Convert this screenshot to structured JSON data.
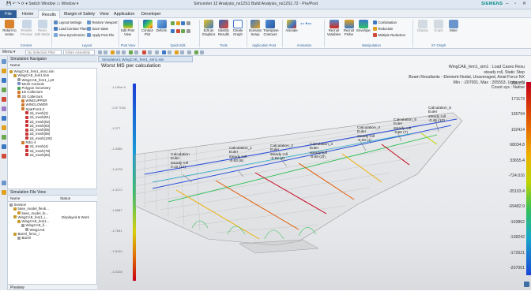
{
  "window": {
    "title": "Simcenter 12 Analysis_nx12S1 Build Analysis_nx12S1.72 - Pre/Post",
    "brand": "SIEMENS",
    "quick_access": "💾 ↶ ↷ ⟳ ▾  Switch Window  ▭ Window ▾"
  },
  "tabs": [
    "File",
    "Home",
    "Results",
    "Margin of Safety",
    "View",
    "Application",
    "Developer"
  ],
  "find_command": "Find a Command",
  "ribbon": {
    "context": {
      "big": [
        {
          "label": "Return to Home"
        },
        {
          "label": "Results Preview"
        },
        {
          "label": "Reset Edit Mode"
        }
      ],
      "group": "Context"
    },
    "layout": {
      "items": [
        "Layout Settings",
        "Load Contour Plans",
        "View Synchronize",
        "Restore Viewport",
        "Save State",
        "Apply Post File"
      ],
      "group": "Layout"
    },
    "postview": {
      "big": [
        {
          "label": "Edit Post View"
        }
      ],
      "group": "Post View"
    },
    "quickedit": {
      "big": [
        {
          "label": "Contour Plot"
        },
        {
          "label": "Deform"
        }
      ],
      "group": "Quick Edit"
    },
    "tools": {
      "big": [
        {
          "label": "Edit as Graphics"
        },
        {
          "label": "Identify Results"
        },
        {
          "label": "Create Graph"
        }
      ],
      "group": "Tools"
    },
    "application": {
      "big": [
        {
          "label": "Scenario Setup"
        },
        {
          "label": "Transpose Contours"
        }
      ],
      "group": "Application Post"
    },
    "animation": {
      "big": [
        {
          "label": "Animate"
        }
      ],
      "group": "Animation"
    },
    "manipulation": {
      "big": [
        {
          "label": "Recruit Variables"
        },
        {
          "label": "Recruit Probe"
        },
        {
          "label": "Envelope"
        }
      ],
      "items": [
        "Combination",
        "Reduction",
        "Multiple Reduction"
      ],
      "group": "Manipulation"
    },
    "xygraph": {
      "big": [
        {
          "label": "Display"
        },
        {
          "label": "Graph"
        },
        {
          "label": "More"
        }
      ],
      "group": "XY Graph"
    }
  },
  "cmdbar": {
    "menu": "Menu ▾",
    "filter1": "No Selection Filter",
    "filter2": "Entire Assembly"
  },
  "navigator": {
    "title": "Simulation Navigator",
    "column": "Name",
    "items": [
      {
        "label": "WingCAE_fem1_sim1.sim",
        "indent": 0,
        "color": "#c79a2b"
      },
      {
        "label": "WingCAE_fem1.fem",
        "indent": 1,
        "color": "#c79a2b"
      },
      {
        "label": "WingCAE_fem1_i.prt",
        "indent": 2,
        "color": "#9a9a9a"
      },
      {
        "label": "Mesh Controls",
        "indent": 2,
        "color": "#7b8fc9"
      },
      {
        "label": "Polygon Geometry",
        "indent": 2,
        "color": "#4aa35b"
      },
      {
        "label": "1D Collectors",
        "indent": 2,
        "color": "#cf7a2b"
      },
      {
        "label": "2D Collectors",
        "indent": 2,
        "color": "#cf7a2b"
      },
      {
        "label": "WINGUPPER",
        "indent": 3,
        "color": "#cf7a2b"
      },
      {
        "label": "WINGLOWER",
        "indent": 3,
        "color": "#cf7a2b"
      },
      {
        "label": "SparFront-3",
        "indent": 3,
        "color": "#cf7a2b"
      },
      {
        "label": "2d_mesh(3)",
        "indent": 4,
        "color": "#c83232"
      },
      {
        "label": "2d_mesh(81)",
        "indent": 4,
        "color": "#c83232"
      },
      {
        "label": "2d_mesh(82)",
        "indent": 4,
        "color": "#c83232"
      },
      {
        "label": "2d_mesh(83)",
        "indent": 4,
        "color": "#c83232"
      },
      {
        "label": "2d_mesh(85)",
        "indent": 4,
        "color": "#c83232"
      },
      {
        "label": "2d_mesh(86)",
        "indent": 4,
        "color": "#c83232"
      },
      {
        "label": "2d_mesh(100)",
        "indent": 4,
        "color": "#c83232"
      },
      {
        "label": "Rib1-4",
        "indent": 3,
        "color": "#cf7a2b"
      },
      {
        "label": "2d_mesh(4)",
        "indent": 4,
        "color": "#c83232"
      },
      {
        "label": "2d_mesh(78)",
        "indent": 4,
        "color": "#c83232"
      },
      {
        "label": "2d_mesh(80)",
        "indent": 4,
        "color": "#c83232"
      }
    ]
  },
  "fileview": {
    "title": "Simulation File View",
    "columns": [
      "Name",
      "Status"
    ],
    "items": [
      {
        "label": "Session",
        "status": "",
        "indent": 0,
        "color": "#9a9a9a"
      },
      {
        "label": "base_model_flexb...",
        "status": "",
        "indent": 1,
        "color": "#c79a2b"
      },
      {
        "label": "base_model_fe...",
        "status": "",
        "indent": 2,
        "color": "#c79a2b"
      },
      {
        "label": "WingCAE_fem1_i...",
        "status": "Displayed & Work",
        "indent": 1,
        "color": "#c79a2b"
      },
      {
        "label": "WingCAE_fem1...",
        "status": "",
        "indent": 2,
        "color": "#c79a2b"
      },
      {
        "label": "WingCAE_fi...",
        "status": "",
        "indent": 3,
        "color": "#9a9a9a"
      },
      {
        "label": "WingCAE",
        "status": "",
        "indent": 4,
        "color": "#9a9a9a"
      },
      {
        "label": "Barrel_fem1_i",
        "status": "",
        "indent": 1,
        "color": "#c79a2b"
      },
      {
        "label": "Barrel",
        "status": "",
        "indent": 2,
        "color": "#9a9a9a"
      }
    ],
    "footer": "Preview"
  },
  "viewport": {
    "tab": "Simulation1 WingCAE_fem1_sim1.sim",
    "title": "Worst MS per calculation",
    "info": [
      "WingCAE_fem1_sim1 : Load Cases Resu",
      "steady roll, Static Step",
      "Beam Resultants - Element-Nodal, Unaveraged, Axial Force NX",
      "Min : -207001, Max : 205553, Units = N",
      "Count sys : Native"
    ],
    "legend": [
      "205553",
      "171173",
      "136794",
      "102414",
      "68034.8",
      "33655.4",
      "-724.016",
      "-35103.4",
      "-69482.9",
      "-103862",
      "-138242",
      "-172621",
      "-207001"
    ],
    "left_scale": [
      "-1.100e+0",
      "-2.57 9.84",
      "-1.277",
      "-1.3356",
      "-1.4178",
      "-1.4172",
      "-1.5887",
      "-1.7841",
      "-1.8140",
      "-1.0228"
    ],
    "callouts": [
      [
        "Calculation",
        "Euler",
        "steady roll",
        "0.10 (17)"
      ],
      [
        "Calculation_1",
        "Euler",
        "steady roll",
        "-0.83 (6)"
      ],
      [
        "Calculation_2",
        "Euler",
        "steady roll",
        "-0.82 (2)"
      ],
      [
        "Calculation_3",
        "Euler",
        "steady roll",
        "-0.68 (3)"
      ],
      [
        "Calculation_4",
        "Euler",
        "steady roll",
        "-0.93 (1)"
      ],
      [
        "Calculation_5",
        "Euler",
        "steady roll",
        "-0.56 (7)"
      ],
      [
        "Calculation_6",
        "Euler",
        "steady roll",
        "-0.46 (13)"
      ]
    ]
  }
}
